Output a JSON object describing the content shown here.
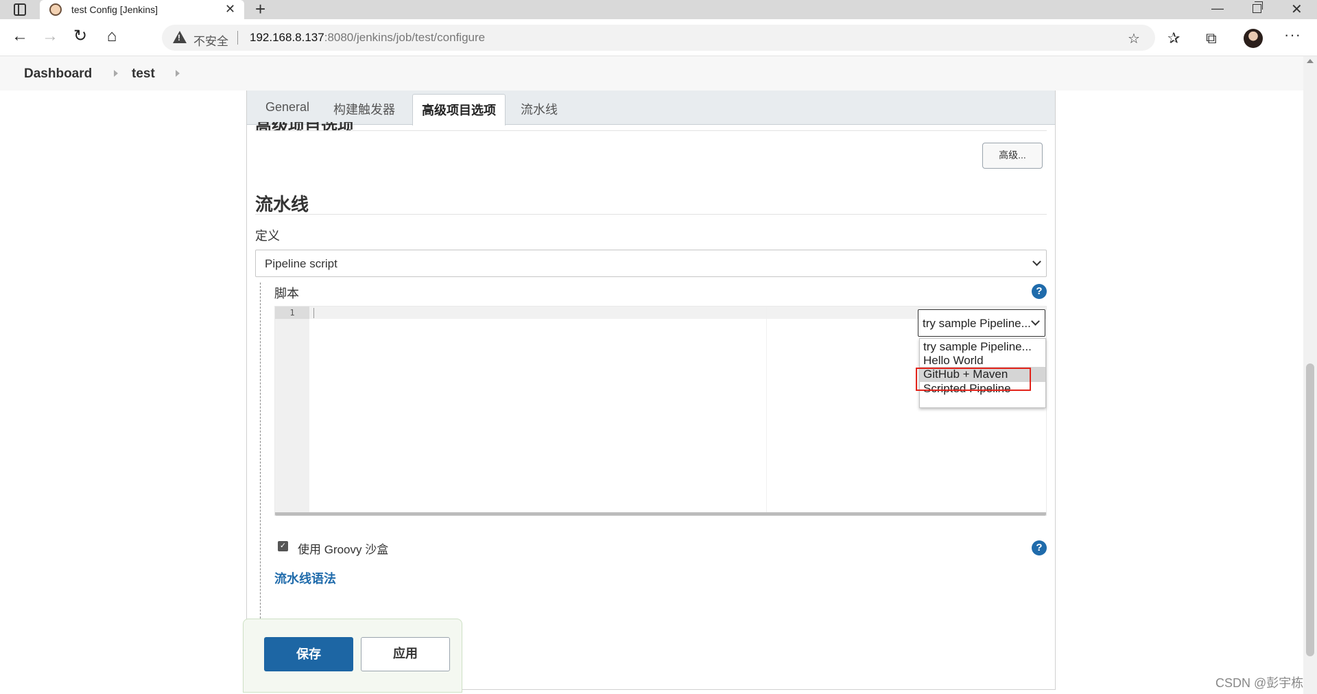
{
  "browser": {
    "tab_title": "test Config [Jenkins]",
    "insecure_label": "不安全",
    "url_host": "192.168.8.137",
    "url_rest": ":8080/jenkins/job/test/configure"
  },
  "breadcrumb": {
    "items": [
      "Dashboard",
      "test"
    ]
  },
  "config_tabs": [
    "General",
    "构建触发器",
    "高级项目选项",
    "流水线"
  ],
  "advanced_section": {
    "heading": "高级项目选项",
    "advanced_button": "高级..."
  },
  "pipeline": {
    "title": "流水线",
    "definition_label": "定义",
    "definition_value": "Pipeline script",
    "script_label": "脚本",
    "line_number": "1",
    "help_symbol": "?",
    "sample_selected": "try sample Pipeline...",
    "sample_options": [
      "try sample Pipeline...",
      "Hello World",
      "GitHub + Maven",
      "Scripted Pipeline"
    ],
    "highlighted_option": "GitHub + Maven",
    "sandbox_label": "使用 Groovy 沙盒",
    "sandbox_checked": true,
    "syntax_link": "流水线语法"
  },
  "footer": {
    "save_label": "保存",
    "apply_label": "应用"
  },
  "watermark": "CSDN @彭宇栋",
  "colors": {
    "accent": "#1d66a4",
    "highlight_box": "#e2231a"
  }
}
